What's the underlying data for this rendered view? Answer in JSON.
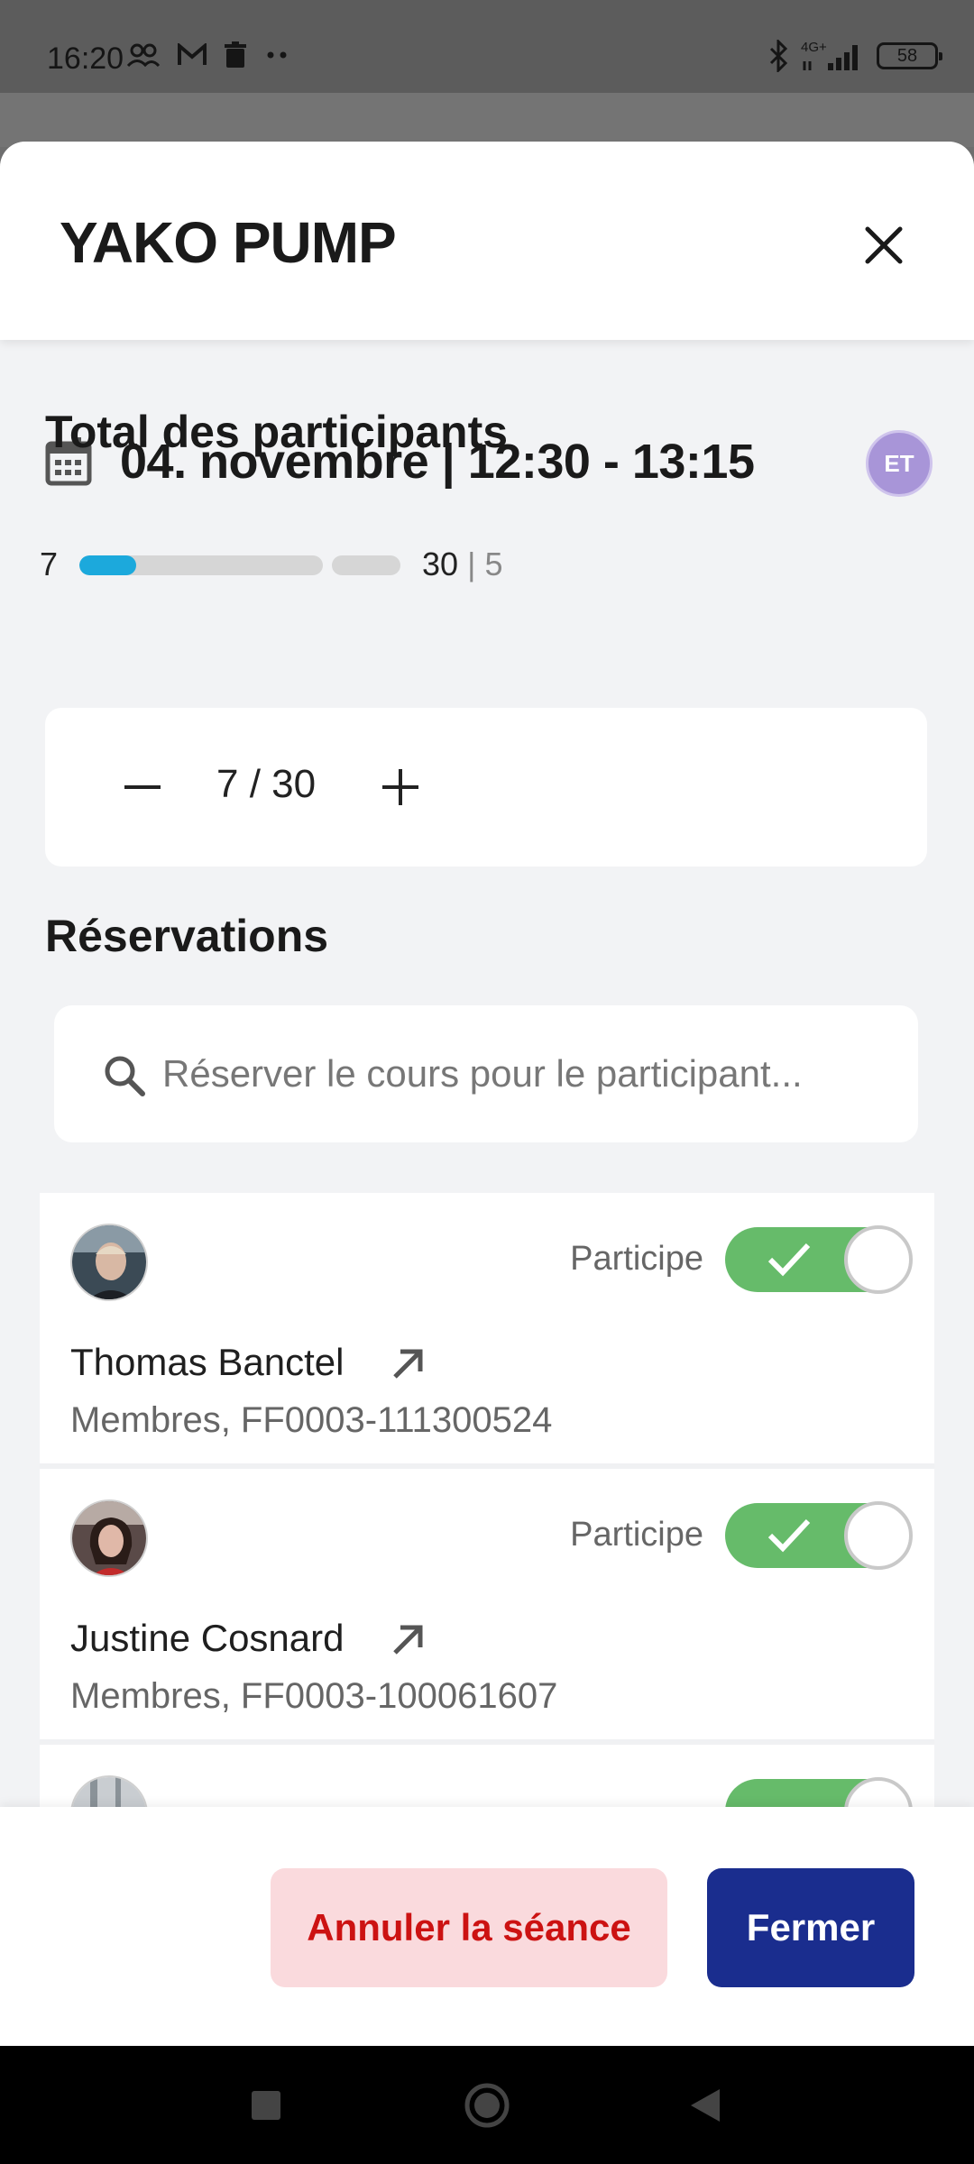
{
  "status_bar": {
    "time": "16:20",
    "network": "4G+",
    "battery": "58"
  },
  "sheet": {
    "title": "YAKO PUMP",
    "date": "04. novembre | 12:30 - 13:15",
    "instructor_initials": "ET",
    "capacity": {
      "booked": "7",
      "max": "30",
      "waitlist": "5",
      "separator": "|",
      "fill_fraction": 0.233
    }
  },
  "participants_total": {
    "title": "Total des participants",
    "value": "7 / 30"
  },
  "reservations": {
    "title": "Réservations",
    "search_placeholder": "Réserver le cours pour le participant...",
    "items": [
      {
        "status": "Participe",
        "name": "Thomas Banctel",
        "info": "Membres, FF0003-111300524",
        "participating": true
      },
      {
        "status": "Participe",
        "name": "Justine Cosnard",
        "info": "Membres, FF0003-100061607",
        "participating": true
      }
    ]
  },
  "footer": {
    "cancel_label": "Annuler la séance",
    "close_label": "Fermer"
  },
  "colors": {
    "accent_blue": "#1a2d8e",
    "progress": "#1ca9dc",
    "toggle_on": "#66bb6a",
    "danger": "#cc1212"
  },
  "icons": [
    "people-icon",
    "gmail-icon",
    "trash-icon",
    "bluetooth-icon",
    "signal-icon",
    "battery-icon",
    "close-icon",
    "calendar-icon",
    "minus-icon",
    "plus-icon",
    "search-icon",
    "check-icon",
    "external-link-icon",
    "nav-square-icon",
    "nav-home-icon",
    "nav-back-icon"
  ]
}
